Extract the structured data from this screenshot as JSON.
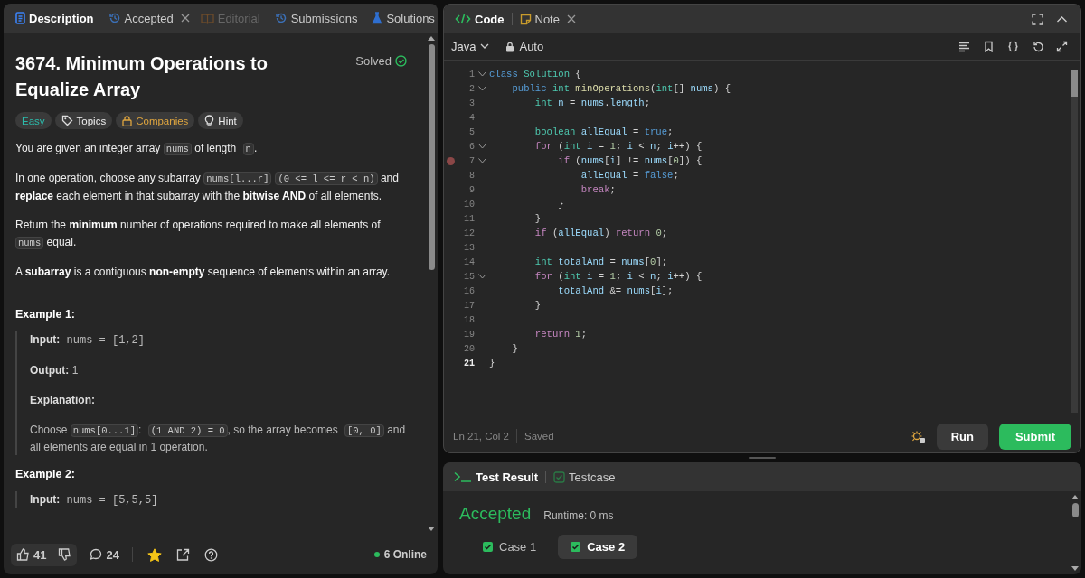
{
  "description_panel": {
    "tabs": [
      {
        "label": "Description",
        "selected": true,
        "disabled": false
      },
      {
        "label": "Accepted",
        "selected": false,
        "disabled": false,
        "closable": true
      },
      {
        "label": "Editorial",
        "selected": false,
        "disabled": true
      },
      {
        "label": "Submissions",
        "selected": false,
        "disabled": false
      },
      {
        "label": "Solutions",
        "selected": false,
        "disabled": false
      }
    ],
    "title": "3674. Minimum Operations to Equalize Array",
    "status": "Solved",
    "tags": [
      {
        "label": "Easy",
        "kind": "difficulty"
      },
      {
        "label": "Topics",
        "kind": "tag"
      },
      {
        "label": "Companies",
        "kind": "lock"
      },
      {
        "label": "Hint",
        "kind": "bulb"
      }
    ],
    "paragraphs": [
      {
        "segments": [
          {
            "kind": "text",
            "text": "You are given an integer array "
          },
          {
            "kind": "code",
            "text": "nums"
          },
          {
            "kind": "text",
            "text": " of length "
          },
          {
            "kind": "code",
            "text": "n"
          },
          {
            "kind": "text",
            "text": "."
          }
        ]
      },
      {
        "segments": [
          {
            "kind": "text",
            "text": "In one operation, choose any subarray "
          },
          {
            "kind": "code",
            "text": "nums[l...r]"
          },
          {
            "kind": "code",
            "text": "(0 <= l <= r < n)"
          },
          {
            "kind": "text",
            "text": " and **replace** each element in that subarray with the **bitwise AND** of all elements."
          }
        ]
      },
      {
        "segments": [
          {
            "kind": "text",
            "text": "Return the **minimum** number of operations required to make all elements of "
          },
          {
            "kind": "code",
            "text": "nums"
          },
          {
            "kind": "text",
            "text": " equal."
          }
        ]
      },
      {
        "segments": [
          {
            "kind": "text",
            "text": "A **subarray** is a contiguous **non-empty** sequence of elements within an array."
          }
        ]
      }
    ],
    "examples": [
      {
        "title": "Example 1:",
        "lines": [
          {
            "kind": "field",
            "label": "Input:",
            "value": "nums = [1,2]",
            "mono": true
          },
          {
            "kind": "field",
            "label": "Output:",
            "value": "1",
            "mono": false
          },
          {
            "kind": "heading",
            "label": "Explanation:"
          },
          {
            "kind": "prose",
            "segments": [
              {
                "kind": "text",
                "text": "Choose "
              },
              {
                "kind": "code",
                "text": "nums[0...1]"
              },
              {
                "kind": "text",
                "text": ": "
              },
              {
                "kind": "code",
                "text": "(1 AND 2) = 0"
              },
              {
                "kind": "text",
                "text": ", so the array becomes "
              },
              {
                "kind": "code",
                "text": "[0, 0]"
              },
              {
                "kind": "text",
                "text": " and all elements are equal in 1 operation."
              }
            ]
          }
        ]
      },
      {
        "title": "Example 2:",
        "lines": [
          {
            "kind": "field",
            "label": "Input:",
            "value": "nums = [5,5,5]",
            "mono": true
          }
        ]
      }
    ],
    "footer": {
      "likes": "41",
      "comments": "24",
      "favorited": true,
      "online": "6 Online"
    }
  },
  "code_panel": {
    "tabs": [
      {
        "label": "Code",
        "selected": true
      },
      {
        "label": "Note",
        "selected": false,
        "closable": true
      }
    ],
    "language": "Java",
    "mode": "Auto",
    "lines": [
      {
        "number": "1",
        "fold": true,
        "tokens": [
          {
            "kind": "keyword",
            "text": "class"
          },
          {
            "kind": "type",
            "text": " Solution"
          },
          {
            "kind": "plain",
            "text": " {"
          }
        ]
      },
      {
        "number": "2",
        "fold": true,
        "tokens": [
          {
            "kind": "keyword",
            "text": "    public"
          },
          {
            "kind": "type",
            "text": " int"
          },
          {
            "kind": "func",
            "text": " minOperations"
          },
          {
            "kind": "plain",
            "text": "("
          },
          {
            "kind": "type",
            "text": "int"
          },
          {
            "kind": "plain",
            "text": "[] "
          },
          {
            "kind": "var",
            "text": "nums"
          },
          {
            "kind": "plain",
            "text": ") {"
          }
        ]
      },
      {
        "number": "3",
        "tokens": [
          {
            "kind": "type",
            "text": "        int"
          },
          {
            "kind": "var",
            "text": " n"
          },
          {
            "kind": "plain",
            "text": " = "
          },
          {
            "kind": "var",
            "text": "nums"
          },
          {
            "kind": "plain",
            "text": "."
          },
          {
            "kind": "var",
            "text": "length"
          },
          {
            "kind": "plain",
            "text": ";"
          }
        ]
      },
      {
        "number": "4"
      },
      {
        "number": "5",
        "tokens": [
          {
            "kind": "type",
            "text": "        boolean"
          },
          {
            "kind": "var",
            "text": " allEqual"
          },
          {
            "kind": "plain",
            "text": " = "
          },
          {
            "kind": "keyword",
            "text": "true"
          },
          {
            "kind": "plain",
            "text": ";"
          }
        ]
      },
      {
        "number": "6",
        "fold": true,
        "tokens": [
          {
            "kind": "control",
            "text": "        for"
          },
          {
            "kind": "plain",
            "text": " ("
          },
          {
            "kind": "type",
            "text": "int"
          },
          {
            "kind": "var",
            "text": " i"
          },
          {
            "kind": "plain",
            "text": " = "
          },
          {
            "kind": "number",
            "text": "1"
          },
          {
            "kind": "plain",
            "text": "; "
          },
          {
            "kind": "var",
            "text": "i"
          },
          {
            "kind": "plain",
            "text": " < "
          },
          {
            "kind": "var",
            "text": "n"
          },
          {
            "kind": "plain",
            "text": "; "
          },
          {
            "kind": "var",
            "text": "i"
          },
          {
            "kind": "plain",
            "text": "++) {"
          }
        ]
      },
      {
        "number": "7",
        "fold": true,
        "breakpoint": true,
        "tokens": [
          {
            "kind": "control",
            "text": "            if"
          },
          {
            "kind": "plain",
            "text": " ("
          },
          {
            "kind": "var",
            "text": "nums"
          },
          {
            "kind": "plain",
            "text": "["
          },
          {
            "kind": "var",
            "text": "i"
          },
          {
            "kind": "plain",
            "text": "] != "
          },
          {
            "kind": "var",
            "text": "nums"
          },
          {
            "kind": "plain",
            "text": "["
          },
          {
            "kind": "number",
            "text": "0"
          },
          {
            "kind": "plain",
            "text": "]) {"
          }
        ]
      },
      {
        "number": "8",
        "tokens": [
          {
            "kind": "var",
            "text": "                allEqual"
          },
          {
            "kind": "plain",
            "text": " = "
          },
          {
            "kind": "keyword",
            "text": "false"
          },
          {
            "kind": "plain",
            "text": ";"
          }
        ]
      },
      {
        "number": "9",
        "tokens": [
          {
            "kind": "control",
            "text": "                break"
          },
          {
            "kind": "plain",
            "text": ";"
          }
        ]
      },
      {
        "number": "10",
        "tokens": [
          {
            "kind": "plain",
            "text": "            }"
          }
        ]
      },
      {
        "number": "11",
        "tokens": [
          {
            "kind": "plain",
            "text": "        }"
          }
        ]
      },
      {
        "number": "12",
        "tokens": [
          {
            "kind": "control",
            "text": "        if"
          },
          {
            "kind": "plain",
            "text": " ("
          },
          {
            "kind": "var",
            "text": "allEqual"
          },
          {
            "kind": "plain",
            "text": ") "
          },
          {
            "kind": "control",
            "text": "return"
          },
          {
            "kind": "number",
            "text": " 0"
          },
          {
            "kind": "plain",
            "text": ";"
          }
        ]
      },
      {
        "number": "13"
      },
      {
        "number": "14",
        "tokens": [
          {
            "kind": "type",
            "text": "        int"
          },
          {
            "kind": "var",
            "text": " totalAnd"
          },
          {
            "kind": "plain",
            "text": " = "
          },
          {
            "kind": "var",
            "text": "nums"
          },
          {
            "kind": "plain",
            "text": "["
          },
          {
            "kind": "number",
            "text": "0"
          },
          {
            "kind": "plain",
            "text": "];"
          }
        ]
      },
      {
        "number": "15",
        "fold": true,
        "tokens": [
          {
            "kind": "control",
            "text": "        for"
          },
          {
            "kind": "plain",
            "text": " ("
          },
          {
            "kind": "type",
            "text": "int"
          },
          {
            "kind": "var",
            "text": " i"
          },
          {
            "kind": "plain",
            "text": " = "
          },
          {
            "kind": "number",
            "text": "1"
          },
          {
            "kind": "plain",
            "text": "; "
          },
          {
            "kind": "var",
            "text": "i"
          },
          {
            "kind": "plain",
            "text": " < "
          },
          {
            "kind": "var",
            "text": "n"
          },
          {
            "kind": "plain",
            "text": "; "
          },
          {
            "kind": "var",
            "text": "i"
          },
          {
            "kind": "plain",
            "text": "++) {"
          }
        ]
      },
      {
        "number": "16",
        "tokens": [
          {
            "kind": "var",
            "text": "            totalAnd"
          },
          {
            "kind": "plain",
            "text": " &= "
          },
          {
            "kind": "var",
            "text": "nums"
          },
          {
            "kind": "plain",
            "text": "["
          },
          {
            "kind": "var",
            "text": "i"
          },
          {
            "kind": "plain",
            "text": "];"
          }
        ]
      },
      {
        "number": "17",
        "tokens": [
          {
            "kind": "plain",
            "text": "        }"
          }
        ]
      },
      {
        "number": "18"
      },
      {
        "number": "19",
        "tokens": [
          {
            "kind": "control",
            "text": "        return"
          },
          {
            "kind": "number",
            "text": " 1"
          },
          {
            "kind": "plain",
            "text": ";"
          }
        ]
      },
      {
        "number": "20",
        "tokens": [
          {
            "kind": "plain",
            "text": "    }"
          }
        ]
      },
      {
        "number": "21",
        "current": true,
        "tokens": [
          {
            "kind": "plain",
            "text": "}"
          }
        ]
      }
    ],
    "cursor": "Ln 21, Col 2",
    "save_state": "Saved",
    "buttons": [
      {
        "label": "Run",
        "kind": "secondary"
      },
      {
        "label": "Submit",
        "kind": "primary"
      }
    ]
  },
  "result_panel": {
    "tabs": [
      {
        "label": "Test Result",
        "selected": true
      },
      {
        "label": "Testcase",
        "selected": false
      }
    ],
    "verdict": "Accepted",
    "runtime": "Runtime: 0 ms",
    "cases": [
      {
        "label": "Case 1",
        "passed": true,
        "selected": false
      },
      {
        "label": "Case 2",
        "passed": true,
        "selected": true
      }
    ]
  }
}
